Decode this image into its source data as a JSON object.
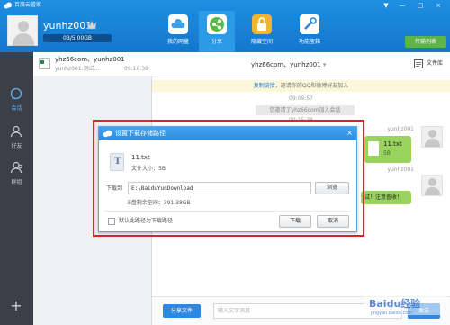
{
  "app": {
    "title": "百度云管家"
  },
  "window": {
    "minimize": "—",
    "maximize": "□",
    "close": "×",
    "menu": "▼"
  },
  "profile": {
    "username": "yunhz001",
    "quota_text": "0B/5.00GB",
    "quota_fraction": 0.0
  },
  "nav": {
    "tabs": [
      {
        "label": "我的网盘",
        "icon": "cloud-icon"
      },
      {
        "label": "分享",
        "icon": "share-icon",
        "active": true
      },
      {
        "label": "隐藏空间",
        "icon": "lock-icon"
      },
      {
        "label": "功能宝箱",
        "icon": "tools-icon"
      }
    ],
    "transfer_label": "传输列表"
  },
  "rail": {
    "items": [
      {
        "label": "会话",
        "icon": "chat-icon",
        "active": true
      },
      {
        "label": "好友",
        "icon": "friend-icon"
      },
      {
        "label": "群组",
        "icon": "group-icon"
      }
    ],
    "add": "+"
  },
  "conversation": {
    "name": "yhz66com、yunhz001",
    "preview": "yunhz001:测试...",
    "time": "09:16:38"
  },
  "chat": {
    "title": "yhz66com、yunhz001",
    "library_label": "文件库",
    "invite_link": "复制链接",
    "invite_text": "，邀请你的QQ和微博好友加入",
    "time1": "09:09:57",
    "system_msg": "您邀请了yhz66com加入会话",
    "time2": "09:15:38",
    "msg1_user": "yunhz001",
    "msg1_file": "11.txt",
    "msg1_size": "5B",
    "msg2_user": "yunhz001",
    "msg2_text": "试！注意查收！",
    "share_button": "分享文件",
    "input_placeholder": "输入文字消息",
    "send_button": "发送"
  },
  "dialog": {
    "title": "设置下载存储路径",
    "file_name": "11.txt",
    "file_size": "文件大小：5B",
    "dest_label": "下载到",
    "dest_path": "E:\\BaiduYunDownload",
    "browse": "浏览",
    "free_space": "E盘剩余空间：391.38GB",
    "default_checkbox": "默认此路径为下载路径",
    "download": "下载",
    "cancel": "取消",
    "close": "×"
  },
  "watermark": {
    "text": "Baidu经验",
    "sub": "jingyan.baidu.com"
  },
  "colors": {
    "brand_blue": "#1d8fe0",
    "rail_bg": "#3a3f48",
    "bubble_green": "#99d25d",
    "highlight_red": "#d9262a"
  }
}
